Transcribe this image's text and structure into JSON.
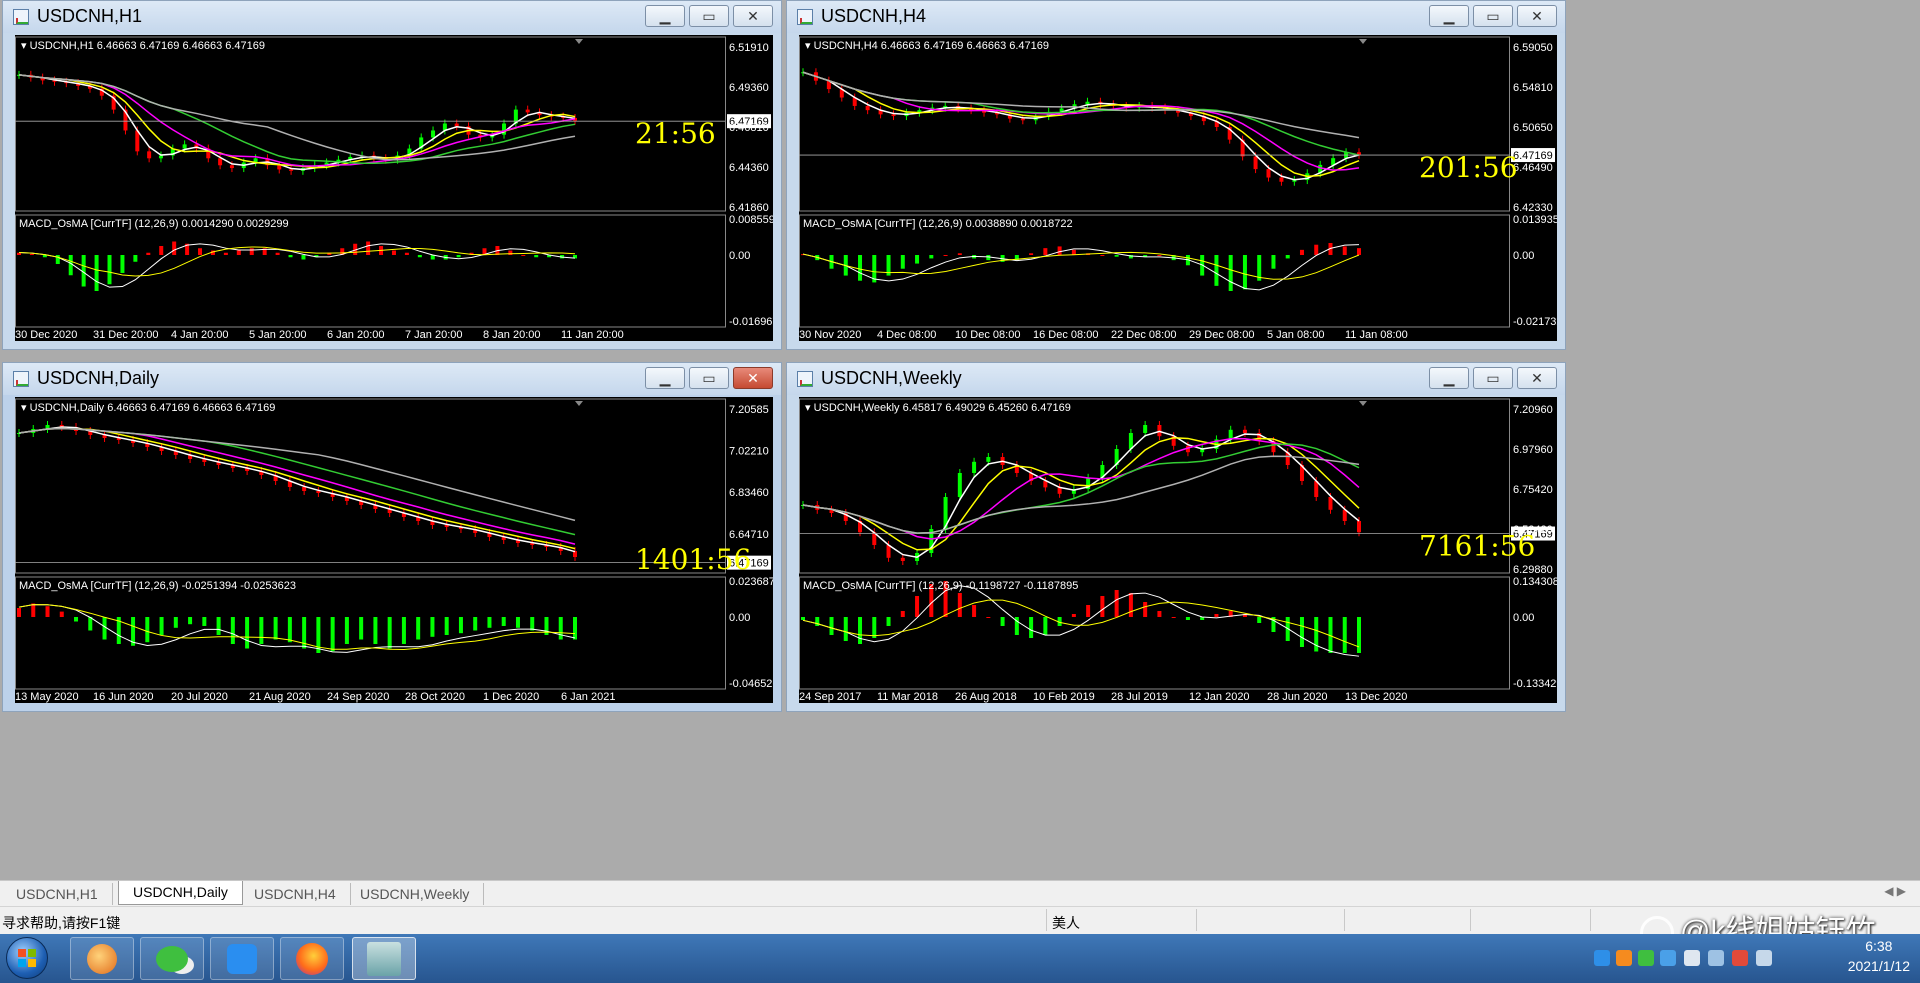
{
  "colors": {
    "bg": "#000000",
    "up": "#00ff00",
    "down": "#ff0000",
    "price": "#ffffff",
    "ma_yellow": "#ffff00",
    "ma_magenta": "#ff00ff",
    "ma_green": "#33cc33",
    "ma_gray": "#b0b0b0",
    "timer": "#ffff00",
    "axis_text": "#ffffff"
  },
  "windows": [
    {
      "id": "h1",
      "title": "USDCNH,H1",
      "active": false,
      "header": "USDCNH,H1  6.46663 6.47169 6.46663 6.47169",
      "price_ticks": [
        "6.51910",
        "6.49360",
        "6.46810",
        "6.44360",
        "6.41860"
      ],
      "current_price": "6.47169",
      "timer": "21:56",
      "macd_label": "MACD_OsMA [CurrTF] (12,26,9) 0.0014290 0.0029299",
      "macd_ticks": [
        "0.0085591",
        "0.00",
        "-0.0169673"
      ],
      "time_labels": [
        "30 Dec 2020",
        "31 Dec 20:00",
        "4 Jan 20:00",
        "5 Jan 20:00",
        "6 Jan 20:00",
        "7 Jan 20:00",
        "8 Jan 20:00",
        "11 Jan 20:00"
      ],
      "chart_data": {
        "type": "line",
        "y_range": [
          6.41,
          6.525
        ],
        "current": 6.47169,
        "close": [
          6.505,
          6.503,
          6.501,
          6.5,
          6.499,
          6.497,
          6.495,
          6.49,
          6.48,
          6.465,
          6.45,
          6.445,
          6.447,
          6.452,
          6.455,
          6.452,
          6.445,
          6.44,
          6.438,
          6.442,
          6.445,
          6.44,
          6.437,
          6.436,
          6.438,
          6.44,
          6.442,
          6.444,
          6.446,
          6.447,
          6.445,
          6.444,
          6.447,
          6.452,
          6.46,
          6.465,
          6.47,
          6.468,
          6.462,
          6.46,
          6.462,
          6.47,
          6.48,
          6.478,
          6.476,
          6.475,
          6.474,
          6.472
        ],
        "macd": [
          0.001,
          0.0005,
          -0.001,
          -0.004,
          -0.009,
          -0.014,
          -0.016,
          -0.013,
          -0.008,
          -0.003,
          0.001,
          0.004,
          0.006,
          0.005,
          0.003,
          0.002,
          0.001,
          0.002,
          0.003,
          0.003,
          0.001,
          -0.001,
          -0.002,
          -0.001,
          0.001,
          0.003,
          0.005,
          0.006,
          0.004,
          0.002,
          0.001,
          -0.001,
          -0.002,
          -0.002,
          -0.001,
          0.001,
          0.003,
          0.004,
          0.002,
          0.0,
          -0.001,
          -0.001,
          -0.0015,
          -0.0015
        ]
      }
    },
    {
      "id": "h4",
      "title": "USDCNH,H4",
      "active": false,
      "header": "USDCNH,H4  6.46663 6.47169 6.46663 6.47169",
      "price_ticks": [
        "6.59050",
        "6.54810",
        "6.50650",
        "6.46490",
        "6.42330"
      ],
      "current_price": "6.47169",
      "timer": "201:56",
      "macd_label": "MACD_OsMA [CurrTF] (12,26,9) 0.0038890 0.0018722",
      "macd_ticks": [
        "0.0139354",
        "0.00",
        "-0.0217328"
      ],
      "time_labels": [
        "30 Nov 2020",
        "4 Dec 08:00",
        "10 Dec 08:00",
        "16 Dec 08:00",
        "22 Dec 08:00",
        "29 Dec 08:00",
        "5 Jan 08:00",
        "11 Jan 08:00"
      ],
      "chart_data": {
        "type": "line",
        "y_range": [
          6.41,
          6.6
        ],
        "current": 6.47169,
        "close": [
          6.57,
          6.56,
          6.55,
          6.54,
          6.53,
          6.525,
          6.52,
          6.518,
          6.522,
          6.525,
          6.528,
          6.53,
          6.527,
          6.525,
          6.522,
          6.52,
          6.515,
          6.513,
          6.518,
          6.523,
          6.527,
          6.532,
          6.535,
          6.532,
          6.53,
          6.528,
          6.53,
          6.528,
          6.525,
          6.522,
          6.518,
          6.512,
          6.505,
          6.49,
          6.47,
          6.455,
          6.445,
          6.44,
          6.442,
          6.45,
          6.46,
          6.468,
          6.475,
          6.472
        ],
        "macd": [
          0.0005,
          -0.003,
          -0.008,
          -0.012,
          -0.015,
          -0.016,
          -0.012,
          -0.008,
          -0.005,
          -0.002,
          0.0,
          0.001,
          -0.002,
          -0.003,
          -0.004,
          -0.003,
          0.001,
          0.004,
          0.005,
          0.003,
          0.001,
          0.0,
          -0.001,
          -0.002,
          -0.001,
          0.0,
          -0.003,
          -0.006,
          -0.012,
          -0.018,
          -0.021,
          -0.02,
          -0.015,
          -0.008,
          -0.002,
          0.003,
          0.006,
          0.007,
          0.005,
          0.004
        ]
      }
    },
    {
      "id": "daily",
      "title": "USDCNH,Daily",
      "active": true,
      "header": "USDCNH,Daily  6.46663 6.47169 6.46663 6.47169",
      "price_ticks": [
        "7.20585",
        "7.02210",
        "6.83460",
        "6.64710"
      ],
      "current_price": "6.47169",
      "timer": "1401:56",
      "macd_label": "MACD_OsMA [CurrTF] (12,26,9) -0.0251394 -0.0253623",
      "macd_ticks": [
        "0.023687",
        "0.00",
        "-0.046526"
      ],
      "time_labels": [
        "13 May 2020",
        "16 Jun 2020",
        "20 Jul 2020",
        "21 Aug 2020",
        "24 Sep 2020",
        "28 Oct 2020",
        "1 Dec 2020",
        "6 Jan 2021"
      ],
      "chart_data": {
        "type": "line",
        "y_range": [
          6.44,
          7.24
        ],
        "current": 6.47169,
        "close": [
          7.12,
          7.14,
          7.16,
          7.15,
          7.13,
          7.11,
          7.095,
          7.085,
          7.07,
          7.05,
          7.03,
          7.01,
          6.99,
          6.975,
          6.96,
          6.945,
          6.93,
          6.91,
          6.88,
          6.85,
          6.83,
          6.82,
          6.8,
          6.78,
          6.76,
          6.74,
          6.72,
          6.7,
          6.68,
          6.66,
          6.65,
          6.64,
          6.62,
          6.6,
          6.585,
          6.57,
          6.56,
          6.55,
          6.53,
          6.5
        ],
        "macd": [
          0.01,
          0.015,
          0.012,
          0.006,
          -0.005,
          -0.015,
          -0.025,
          -0.03,
          -0.032,
          -0.028,
          -0.02,
          -0.012,
          -0.008,
          -0.01,
          -0.02,
          -0.03,
          -0.035,
          -0.03,
          -0.025,
          -0.028,
          -0.035,
          -0.04,
          -0.038,
          -0.03,
          -0.025,
          -0.03,
          -0.035,
          -0.03,
          -0.025,
          -0.022,
          -0.02,
          -0.018,
          -0.015,
          -0.012,
          -0.01,
          -0.012,
          -0.015,
          -0.02,
          -0.025,
          -0.025
        ]
      }
    },
    {
      "id": "weekly",
      "title": "USDCNH,Weekly",
      "active": false,
      "header": "USDCNH,Weekly  6.45817 6.49029 6.45260 6.47169",
      "price_ticks": [
        "7.20960",
        "6.97960",
        "6.75420",
        "6.52420",
        "6.29880"
      ],
      "current_price": "6.47169",
      "timer": "7161:56",
      "macd_label": "MACD_OsMA [CurrTF] (12,26,9) -0.1198727 -0.1187895",
      "macd_ticks": [
        "0.1343086",
        "0.00",
        "-0.1334299"
      ],
      "time_labels": [
        "24 Sep 2017",
        "11 Mar 2018",
        "26 Aug 2018",
        "10 Feb 2019",
        "28 Jul 2019",
        "12 Jan 2020",
        "28 Jun 2020",
        "13 Dec 2020"
      ],
      "chart_data": {
        "type": "line",
        "y_range": [
          6.25,
          7.25
        ],
        "current": 6.47169,
        "close": [
          6.65,
          6.62,
          6.6,
          6.55,
          6.48,
          6.4,
          6.32,
          6.3,
          6.35,
          6.5,
          6.7,
          6.85,
          6.92,
          6.95,
          6.9,
          6.85,
          6.8,
          6.76,
          6.72,
          6.75,
          6.82,
          6.9,
          7.0,
          7.1,
          7.15,
          7.08,
          7.02,
          6.98,
          7.0,
          7.06,
          7.12,
          7.1,
          7.05,
          6.98,
          6.9,
          6.8,
          6.7,
          6.62,
          6.55,
          6.48
        ],
        "macd": [
          -0.01,
          -0.03,
          -0.06,
          -0.08,
          -0.09,
          -0.07,
          -0.03,
          0.02,
          0.07,
          0.11,
          0.12,
          0.08,
          0.04,
          0.0,
          -0.03,
          -0.06,
          -0.07,
          -0.06,
          -0.03,
          0.01,
          0.04,
          0.07,
          0.09,
          0.08,
          0.05,
          0.02,
          0.0,
          -0.01,
          -0.01,
          0.01,
          0.02,
          0.01,
          -0.02,
          -0.05,
          -0.08,
          -0.1,
          -0.115,
          -0.12,
          -0.12,
          -0.12
        ]
      }
    }
  ],
  "tabs": [
    {
      "label": "USDCNH,H1",
      "active": false
    },
    {
      "label": "USDCNH,Daily",
      "active": true
    },
    {
      "label": "USDCNH,H4",
      "active": false
    },
    {
      "label": "USDCNH,Weekly",
      "active": false
    }
  ],
  "status": {
    "help": "寻求帮助,请按F1键",
    "profile": "美人"
  },
  "watermark": "@k线姐姑钰竹",
  "clock": {
    "time": "6:38",
    "date": "2021/1/12"
  }
}
